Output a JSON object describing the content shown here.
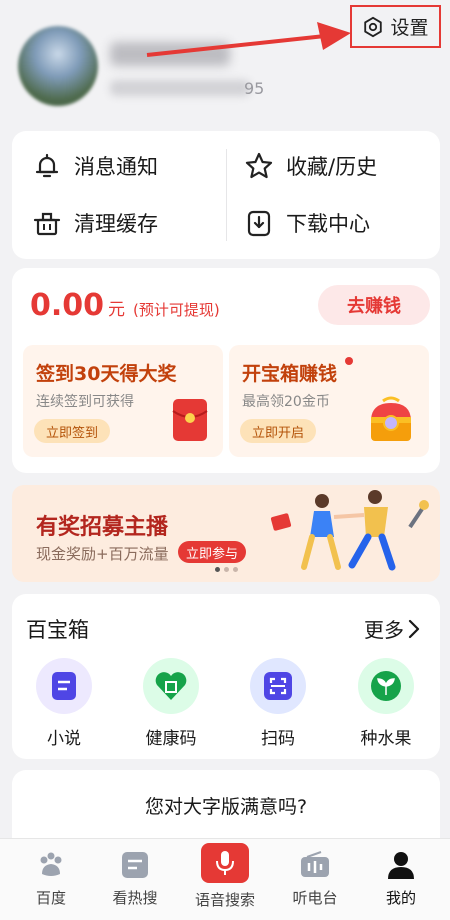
{
  "header": {
    "masked_id_tail": "95",
    "settings_label": "设置"
  },
  "menu": {
    "items": [
      {
        "label": "消息通知",
        "icon": "bell-icon"
      },
      {
        "label": "收藏/历史",
        "icon": "star-icon"
      },
      {
        "label": "清理缓存",
        "icon": "trash-icon"
      },
      {
        "label": "下载中心",
        "icon": "download-icon"
      }
    ]
  },
  "earn": {
    "amount": "0.00",
    "unit": "元",
    "hint": "(预计可提现)",
    "button": "去赚钱",
    "tasks": [
      {
        "title": "签到30天得大奖",
        "desc": "连续签到可获得",
        "button": "立即签到"
      },
      {
        "title": "开宝箱赚钱",
        "desc": "最高领20金币",
        "button": "立即开启"
      }
    ]
  },
  "banner": {
    "title": "有奖招募主播",
    "subtitle": "现金奖励+百万流量",
    "button": "立即参与"
  },
  "toolbox": {
    "title": "百宝箱",
    "more": "更多",
    "items": [
      {
        "label": "小说",
        "icon": "novel-icon"
      },
      {
        "label": "健康码",
        "icon": "health-code-icon"
      },
      {
        "label": "扫码",
        "icon": "scan-icon"
      },
      {
        "label": "种水果",
        "icon": "fruit-sprout-icon"
      }
    ]
  },
  "survey": {
    "question": "您对大字版满意吗?"
  },
  "tabbar": {
    "items": [
      {
        "label": "百度",
        "icon": "baidu-paw-icon"
      },
      {
        "label": "看热搜",
        "icon": "hot-search-icon"
      },
      {
        "label": "语音搜索",
        "icon": "microphone-icon"
      },
      {
        "label": "听电台",
        "icon": "radio-icon"
      },
      {
        "label": "我的",
        "icon": "user-icon"
      }
    ]
  },
  "colors": {
    "accent": "#e53935",
    "background": "#f2f2f4"
  }
}
